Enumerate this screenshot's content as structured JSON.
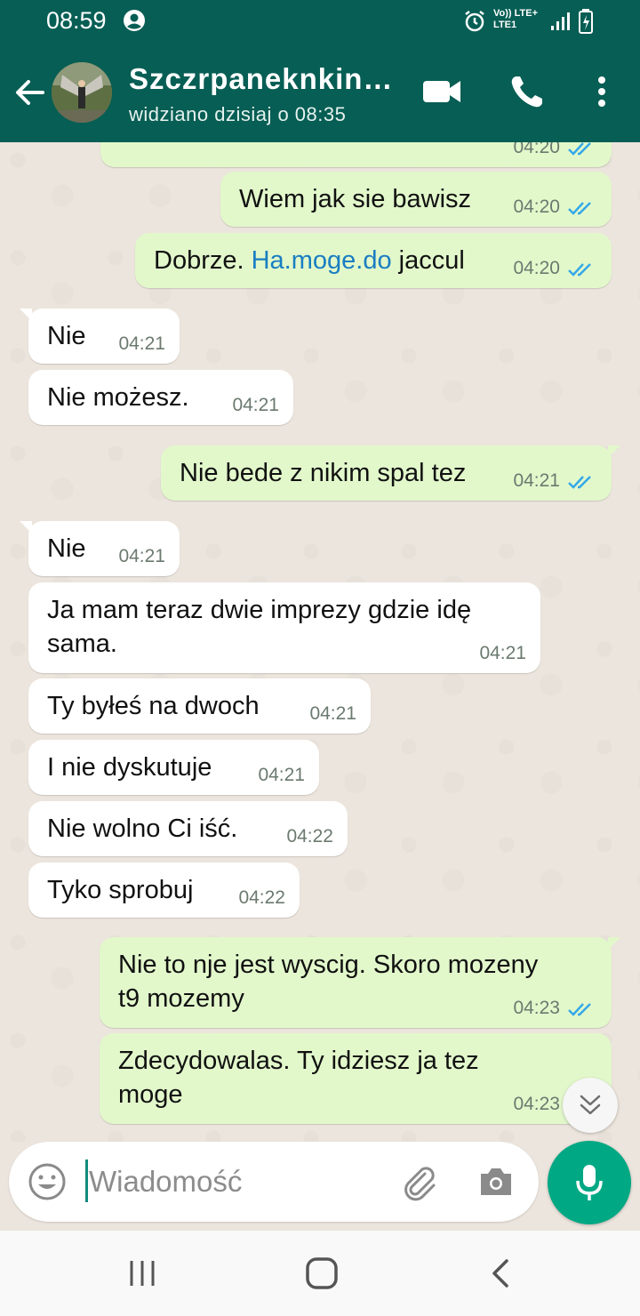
{
  "status_bar": {
    "time": "08:59",
    "network_line1": "Vo)) LTE+",
    "network_line2": "LTE1"
  },
  "header": {
    "contact_name": "Szczrpaneknkin…",
    "contact_status": "widziano dzisiaj o 08:35",
    "icons": [
      "back-arrow-icon",
      "avatar",
      "video-call-icon",
      "phone-icon",
      "more-vert-icon"
    ]
  },
  "messages": [
    {
      "dir": "out",
      "time": "04:20",
      "read": true,
      "partial": true
    },
    {
      "dir": "out",
      "text": "Wiem jak sie bawisz",
      "time": "04:20",
      "read": true
    },
    {
      "dir": "out",
      "text_before": "Dobrze. ",
      "link": "Ha.moge.do",
      "text_after": " jaccul",
      "time": "04:20",
      "read": true
    },
    {
      "dir": "in",
      "text": "Nie",
      "time": "04:21"
    },
    {
      "dir": "in",
      "text": "Nie możesz.",
      "time": "04:21"
    },
    {
      "dir": "out",
      "text": "Nie bede z nikim spal tez",
      "time": "04:21",
      "read": true
    },
    {
      "dir": "in",
      "text": "Nie",
      "time": "04:21"
    },
    {
      "dir": "in",
      "lines": [
        "Ja mam teraz dwie imprezy gdzie idę",
        "sama."
      ],
      "time": "04:21"
    },
    {
      "dir": "in",
      "text": "Ty byłeś na dwoch",
      "time": "04:21"
    },
    {
      "dir": "in",
      "text": "I nie dyskutuje",
      "time": "04:21"
    },
    {
      "dir": "in",
      "text": "Nie wolno Ci iść.",
      "time": "04:22"
    },
    {
      "dir": "in",
      "text": "Tyko sprobuj",
      "time": "04:22"
    },
    {
      "dir": "out",
      "lines": [
        "Nie to nje jest wyscig. Skoro mozeny",
        "t9 mozemy"
      ],
      "time": "04:23",
      "read": true
    },
    {
      "dir": "out",
      "lines": [
        "Zdecydowalas. Ty idziesz ja tez",
        "moge"
      ],
      "time": "04:23",
      "read": true
    }
  ],
  "composer": {
    "placeholder": "Wiadomość"
  },
  "colors": {
    "header": "#075e54",
    "accent": "#00a884",
    "bubble_out": "#e2f8cb",
    "bubble_in": "#ffffff",
    "link": "#1a7ec2",
    "read_ticks": "#34a8e8"
  }
}
